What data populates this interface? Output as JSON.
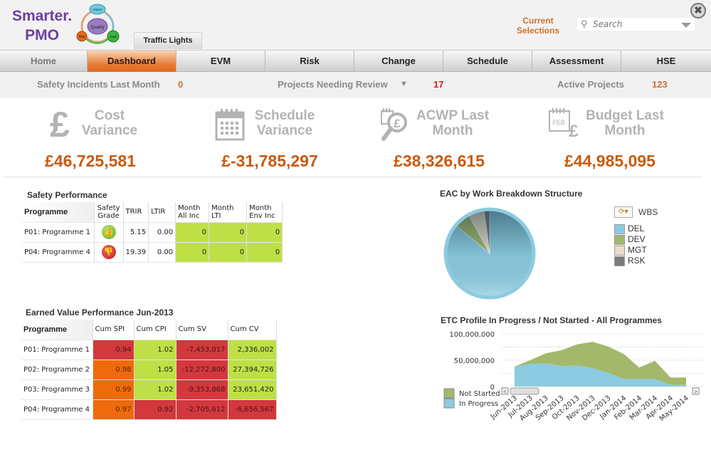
{
  "header": {
    "logo_line1": "Smarter.",
    "logo_line2": "PMO",
    "logo_cycle": {
      "center": "Quality",
      "nodes": [
        "Vision",
        "Cost",
        "Time"
      ]
    },
    "traffic_tab": "Traffic Lights",
    "current_selections": "Current Selections",
    "search_placeholder": "Search",
    "icons": {
      "search": "magnifier-icon",
      "dropdown": "chevron-down-icon",
      "close": "close-icon"
    }
  },
  "nav": {
    "items": [
      {
        "label": "Home",
        "state": "normal"
      },
      {
        "label": "Dashboard",
        "state": "active"
      },
      {
        "label": "EVM",
        "state": "normal"
      },
      {
        "label": "Risk",
        "state": "normal"
      },
      {
        "label": "Change",
        "state": "normal"
      },
      {
        "label": "Schedule",
        "state": "normal"
      },
      {
        "label": "Assessment",
        "state": "normal"
      },
      {
        "label": "HSE",
        "state": "normal"
      }
    ]
  },
  "kpis": {
    "safety_label": "Safety Incidents Last Month",
    "safety_value": "0",
    "review_label": "Projects Needing Review",
    "review_value": "17",
    "active_label": "Active Projects",
    "active_value": "123",
    "colors": {
      "orange": "#d0702a",
      "red": "#d42020"
    }
  },
  "tiles": [
    {
      "icon": "pound-icon",
      "title_1": "Cost",
      "title_2": "Variance",
      "value": "£46,725,581"
    },
    {
      "icon": "calendar-icon",
      "title_1": "Schedule",
      "title_2": "Variance",
      "value": "£-31,785,297"
    },
    {
      "icon": "magnifier-pound-icon",
      "title_1": "ACWP Last",
      "title_2": "Month",
      "value": "£38,326,615"
    },
    {
      "icon": "calendar-pound-icon",
      "title_1": "Budget Last",
      "title_2": "Month",
      "value": "£44,985,095"
    }
  ],
  "safety": {
    "title": "Safety Performance",
    "headers": [
      "Programme",
      "Safety Grade",
      "TRIR",
      "LTIR",
      "Month All Inc",
      "Month LTI",
      "Month Env Inc"
    ],
    "rows": [
      {
        "programme": "P01: Programme 1",
        "grade": "thumbs-up",
        "trir": "5.15",
        "ltir": "0.00",
        "all_inc": "0",
        "lti": "0",
        "env_inc": "0"
      },
      {
        "programme": "P04: Programme 4",
        "grade": "thumbs-down",
        "trir": "19.39",
        "ltir": "0.00",
        "all_inc": "0",
        "lti": "0",
        "env_inc": "0"
      }
    ]
  },
  "evp": {
    "title": "Earned Value Performance Jun-2013",
    "headers": [
      "Programme",
      "Cum SPI",
      "Cum CPI",
      "Cum SV",
      "Cum CV"
    ],
    "rows": [
      {
        "programme": "P01: Programme 1",
        "spi": "0.94",
        "spi_status": "r",
        "cpi": "1.02",
        "cpi_status": "g",
        "sv": "-7,453,017",
        "sv_status": "r",
        "cv": "2,336,002",
        "cv_status": "g"
      },
      {
        "programme": "P02: Programme 2",
        "spi": "0.98",
        "spi_status": "o",
        "cpi": "1.05",
        "cpi_status": "g",
        "sv": "-12,272,800",
        "sv_status": "r",
        "cv": "27,394,726",
        "cv_status": "g"
      },
      {
        "programme": "P03: Programme 3",
        "spi": "0.99",
        "spi_status": "o",
        "cpi": "1.02",
        "cpi_status": "g",
        "sv": "-9,353,868",
        "sv_status": "r",
        "cv": "23,651,420",
        "cv_status": "g"
      },
      {
        "programme": "P04: Programme 4",
        "spi": "0.97",
        "spi_status": "o",
        "cpi": "0.92",
        "cpi_status": "r",
        "sv": "-2,705,612",
        "sv_status": "r",
        "cv": "-6,656,567",
        "cv_status": "r"
      }
    ]
  },
  "chart_data": [
    {
      "type": "pie",
      "title": "EAC by Work Breakdown Structure",
      "legend_title": "WBS",
      "legend_position": "right",
      "categories": [
        "DEL",
        "DEV",
        "MGT",
        "RSK"
      ],
      "values": [
        86,
        6,
        6,
        2
      ],
      "colors": [
        "#8ccbe0",
        "#a3b86a",
        "#ecdcc8",
        "#7a7a7a"
      ]
    },
    {
      "type": "area",
      "stacked": true,
      "title": "ETC Profile In Progress / Not Started - All Programmes",
      "xlabel": "",
      "ylabel": "",
      "ylim": [
        0,
        100000000
      ],
      "yticks": [
        "0",
        "50,000,000",
        "100,000,000"
      ],
      "grid": true,
      "legend_position": "bottom-left",
      "categories": [
        "Jun-2013",
        "Jul-2013",
        "Aug-2013",
        "Sep-2013",
        "Oct-2013",
        "Nov-2013",
        "Dec-2013",
        "Jan-2014",
        "Feb-2014",
        "Mar-2014",
        "Apr-2014",
        "May-2014"
      ],
      "series": [
        {
          "name": "In Progress",
          "color": "#8ccbe0",
          "values": [
            38000000,
            43000000,
            44000000,
            39000000,
            40000000,
            35000000,
            26000000,
            14000000,
            14000000,
            14000000,
            3000000,
            3000000
          ]
        },
        {
          "name": "Not Started",
          "color": "#a3b86a",
          "values": [
            0,
            7000000,
            19000000,
            30000000,
            40000000,
            50000000,
            50000000,
            48000000,
            22000000,
            35000000,
            14000000,
            14000000
          ]
        }
      ]
    }
  ]
}
